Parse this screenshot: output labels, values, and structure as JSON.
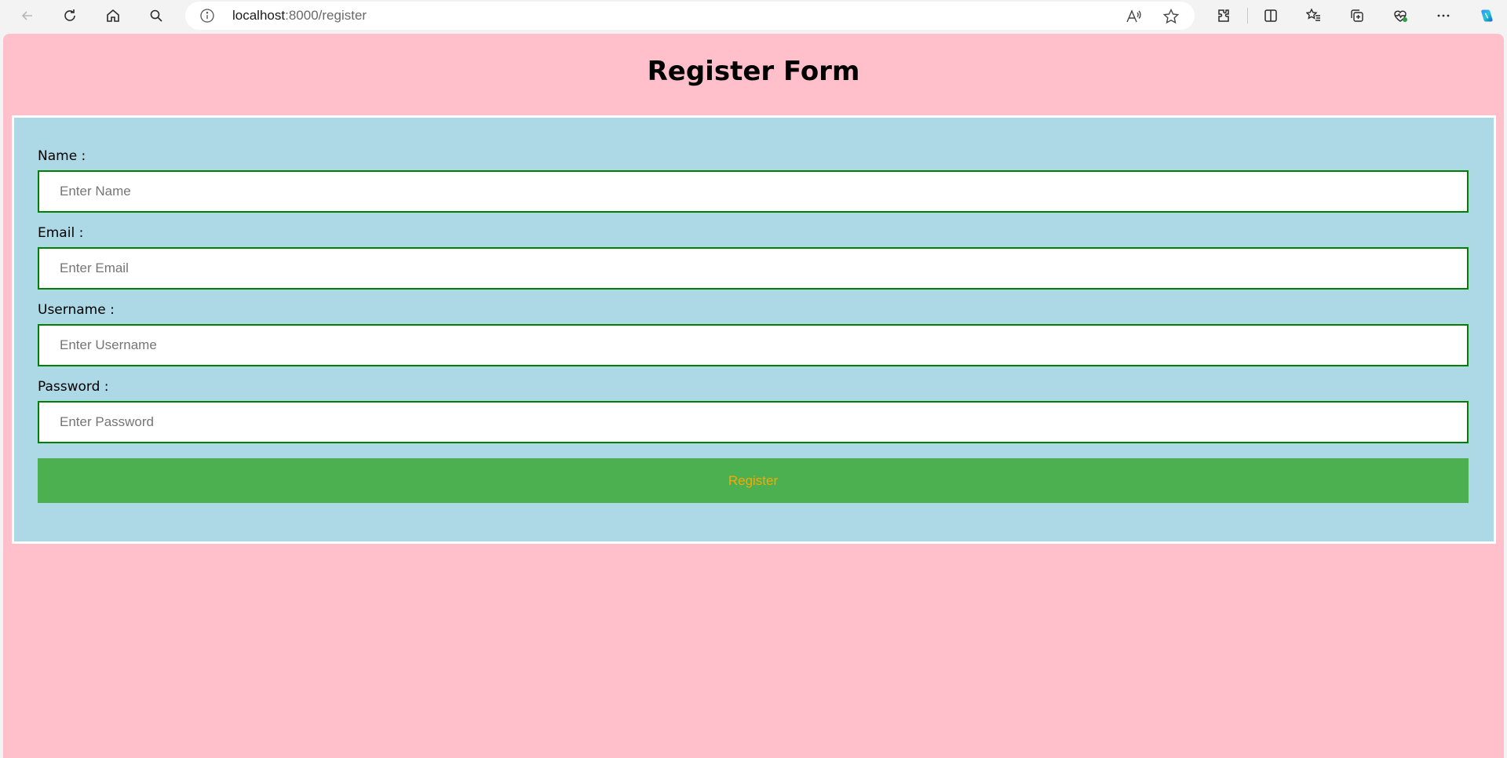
{
  "browser": {
    "url_host": "localhost",
    "url_rest": ":8000/register"
  },
  "page": {
    "title": "Register Form",
    "background_color": "#ffc0cb",
    "form_background_color": "#add8e6"
  },
  "form": {
    "fields": [
      {
        "label": "Name :",
        "placeholder": "Enter Name",
        "value": ""
      },
      {
        "label": "Email :",
        "placeholder": "Enter Email",
        "value": ""
      },
      {
        "label": "Username :",
        "placeholder": "Enter Username",
        "value": ""
      },
      {
        "label": "Password :",
        "placeholder": "Enter Password",
        "value": ""
      }
    ],
    "submit_label": "Register",
    "submit_color": "#4caf50",
    "submit_text_color": "#ffa500",
    "input_border_color": "#008000"
  },
  "icons": {
    "back": "back-arrow-icon",
    "refresh": "refresh-icon",
    "home": "home-icon",
    "search": "search-icon",
    "site_info": "info-icon",
    "read_aloud": "read-aloud-icon",
    "favorite": "star-icon",
    "extensions": "puzzle-icon",
    "split_screen": "split-screen-icon",
    "favorites": "favorites-list-icon",
    "collections": "collections-icon",
    "browser_essentials": "heart-pulse-icon",
    "more": "more-icon",
    "copilot": "copilot-icon"
  }
}
